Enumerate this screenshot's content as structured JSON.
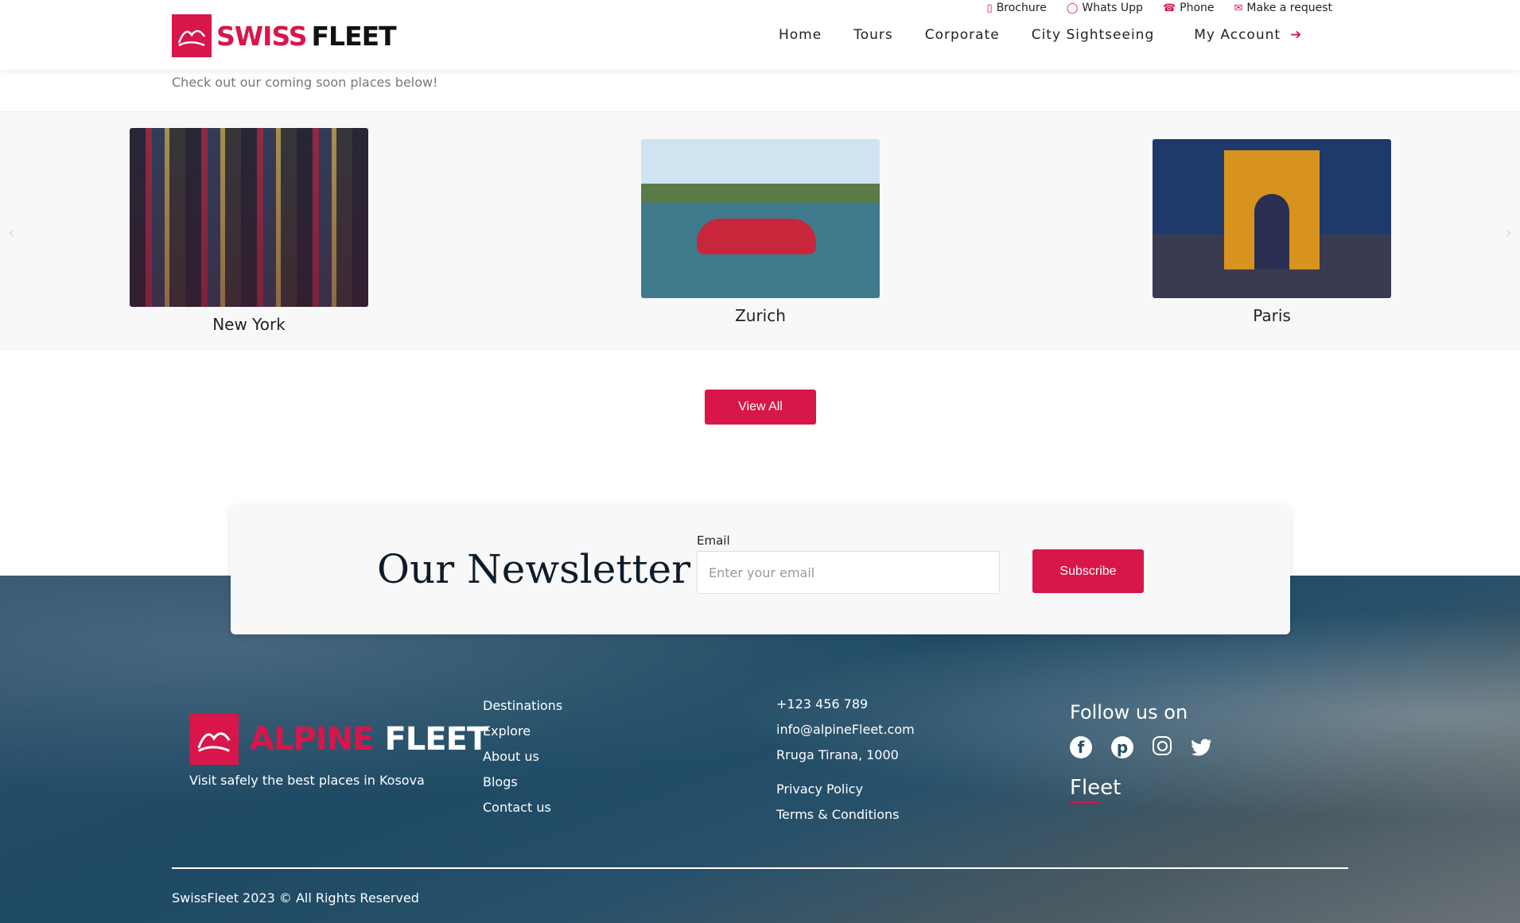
{
  "header": {
    "logo": {
      "part_a": "SWISS",
      "part_b": "FLEET"
    },
    "topbar": [
      {
        "label": "Brochure",
        "icon": "file-icon"
      },
      {
        "label": "Whats Upp",
        "icon": "whatsapp-icon"
      },
      {
        "label": "Phone",
        "icon": "phone-icon"
      },
      {
        "label": "Make a request",
        "icon": "envelope-icon"
      }
    ],
    "nav": [
      "Home",
      "Tours",
      "Corporate",
      "City Sightseeing"
    ],
    "account_label": "My Account"
  },
  "subtitle": "Check out our coming soon places below!",
  "carousel": {
    "items": [
      {
        "name": "New York"
      },
      {
        "name": "Zurich"
      },
      {
        "name": "Paris"
      }
    ]
  },
  "view_all_label": "View All",
  "newsletter": {
    "title": "Our Newsletter",
    "email_label": "Email",
    "email_placeholder": "Enter your email",
    "button_label": "Subscribe"
  },
  "footer": {
    "logo": {
      "part_a": "ALPINE",
      "part_b": "FLEET"
    },
    "tagline": "Visit safely the best places in Kosova",
    "links": [
      "Destinations",
      "Explore",
      "About us",
      "Blogs",
      "Contact us"
    ],
    "contact": {
      "phone": "+123 456 789",
      "email": "info@alpineFleet.com",
      "address": "Rruga Tirana, 1000",
      "privacy": "Privacy Policy",
      "terms": "Terms & Conditions"
    },
    "follow_title": "Follow us on",
    "brand": "Fleet",
    "copyright": "SwissFleet 2023 © All Rights Reserved"
  },
  "colors": {
    "accent": "#d8164a",
    "footer_bg": "#1e4a64"
  }
}
